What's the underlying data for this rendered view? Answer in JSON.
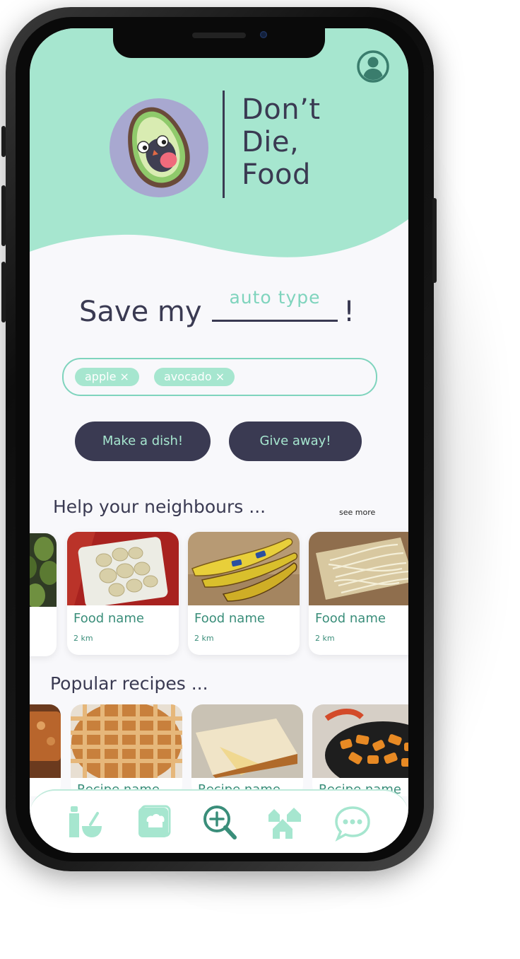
{
  "brand": {
    "line1": "Don’t",
    "line2": "Die,",
    "line3": "Food"
  },
  "hero": {
    "prefix": "Save my",
    "typed_placeholder": "auto type",
    "suffix": "!"
  },
  "tags": [
    {
      "label": "apple ×"
    },
    {
      "label": "avocado ×"
    }
  ],
  "actions": {
    "make_dish": "Make a dish!",
    "give_away": "Give away!"
  },
  "neighbours": {
    "title": "Help your neighbours ...",
    "see_more": "see more",
    "items": [
      {
        "name": "Food name",
        "distance": "2 km",
        "image": "potatoes"
      },
      {
        "name": "Food name",
        "distance": "2 km",
        "image": "bananas"
      },
      {
        "name": "Food name",
        "distance": "2 km",
        "image": "bean-sprouts"
      }
    ]
  },
  "recipes": {
    "title": "Popular recipes ...",
    "items": [
      {
        "name": "Recipe name",
        "image": "lattice-pie"
      },
      {
        "name": "Recipe name",
        "image": "sponge-cake"
      },
      {
        "name": "Recipe name",
        "image": "roasted-vegetables"
      }
    ]
  },
  "nav": {
    "items": [
      {
        "icon": "pantry-icon"
      },
      {
        "icon": "cookbook-icon"
      },
      {
        "icon": "search-add-icon"
      },
      {
        "icon": "neighbourhood-icon"
      },
      {
        "icon": "chat-icon"
      }
    ]
  },
  "colors": {
    "mint": "#a6e6cf",
    "navy": "#3a3a52",
    "teal": "#3a8e7a",
    "accent": "#7fd4bd"
  }
}
